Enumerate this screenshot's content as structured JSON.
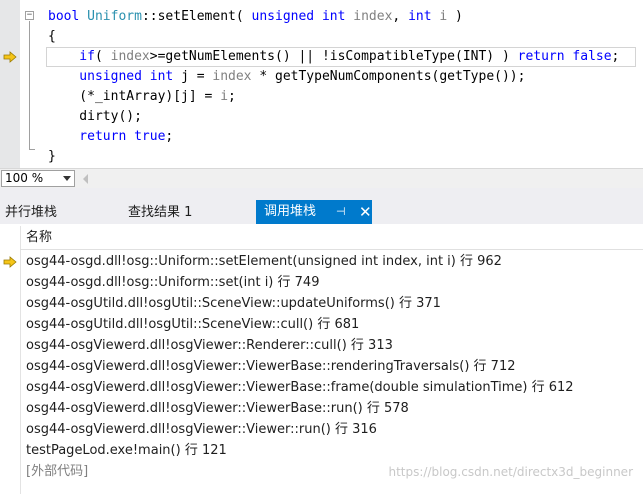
{
  "editor": {
    "lines": [
      {
        "parts": [
          {
            "t": "bool ",
            "c": "kw"
          },
          {
            "t": "Uniform",
            "c": "ty"
          },
          {
            "t": "::setElement( ",
            "c": ""
          },
          {
            "t": "unsigned int ",
            "c": "kw"
          },
          {
            "t": "index",
            "c": "pm"
          },
          {
            "t": ", ",
            "c": ""
          },
          {
            "t": "int ",
            "c": "kw"
          },
          {
            "t": "i",
            "c": "pm"
          },
          {
            "t": " )",
            "c": ""
          }
        ]
      },
      {
        "parts": [
          {
            "t": "{",
            "c": ""
          }
        ]
      },
      {
        "parts": [
          {
            "t": "    if",
            "c": "kw"
          },
          {
            "t": "( ",
            "c": ""
          },
          {
            "t": "index",
            "c": "pm"
          },
          {
            "t": ">=getNumElements() || !isCompatibleType(INT) ) ",
            "c": ""
          },
          {
            "t": "return false",
            "c": "kw"
          },
          {
            "t": ";",
            "c": ""
          }
        ]
      },
      {
        "parts": [
          {
            "t": "    unsigned int ",
            "c": "kw"
          },
          {
            "t": "j = ",
            "c": ""
          },
          {
            "t": "index",
            "c": "pm"
          },
          {
            "t": " * getTypeNumComponents(getType());",
            "c": ""
          }
        ]
      },
      {
        "parts": [
          {
            "t": "    (*_intArray)[j] = ",
            "c": ""
          },
          {
            "t": "i",
            "c": "pm"
          },
          {
            "t": ";",
            "c": ""
          }
        ]
      },
      {
        "parts": [
          {
            "t": "    dirty();",
            "c": ""
          }
        ]
      },
      {
        "parts": [
          {
            "t": "    return true",
            "c": "kw"
          },
          {
            "t": ";",
            "c": ""
          }
        ]
      },
      {
        "parts": [
          {
            "t": "}",
            "c": ""
          }
        ]
      }
    ]
  },
  "zoom": {
    "value": "100 %"
  },
  "tabs": [
    {
      "label": "并行堆栈"
    },
    {
      "label": "查找结果 1"
    },
    {
      "label": "调用堆栈",
      "pin": "⊣",
      "close": "✕"
    }
  ],
  "callstack": {
    "header": "名称",
    "rows": [
      "osg44-osgd.dll!osg::Uniform::setElement(unsigned int index, int i) 行 962",
      "osg44-osgd.dll!osg::Uniform::set(int i) 行 749",
      "osg44-osgUtild.dll!osgUtil::SceneView::updateUniforms() 行 371",
      "osg44-osgUtild.dll!osgUtil::SceneView::cull() 行 681",
      "osg44-osgViewerd.dll!osgViewer::Renderer::cull() 行 313",
      "osg44-osgViewerd.dll!osgViewer::ViewerBase::renderingTraversals() 行 712",
      "osg44-osgViewerd.dll!osgViewer::ViewerBase::frame(double simulationTime) 行 612",
      "osg44-osgViewerd.dll!osgViewer::ViewerBase::run() 行 578",
      "osg44-osgViewerd.dll!osgViewer::Viewer::run() 行 316",
      "testPageLod.exe!main() 行 121",
      "[外部代码]"
    ],
    "watermark": "https://blog.csdn.net/directx3d_beginner"
  },
  "colors": {
    "accent": "#007acc",
    "arrow": "#f5c518",
    "keyword": "#0000ff",
    "type": "#2b91af"
  }
}
